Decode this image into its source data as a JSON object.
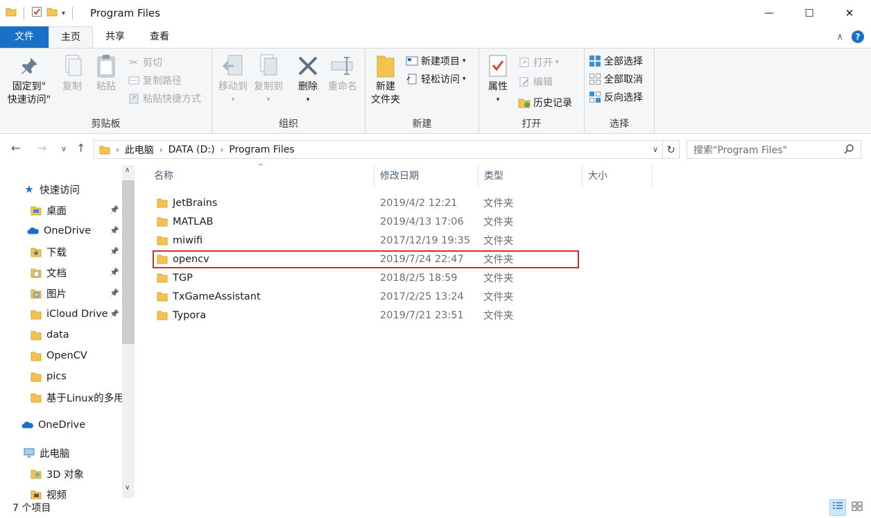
{
  "window": {
    "title": "Program Files",
    "min_glyph": "—",
    "max_glyph": "☐",
    "close_glyph": "✕"
  },
  "ribbon_tabs": [
    "文件",
    "主页",
    "共享",
    "查看"
  ],
  "ribbon": {
    "clipboard": {
      "label": "剪贴板",
      "pin_line1": "固定到\"",
      "pin_line2": "快速访问\"",
      "copy": "复制",
      "paste": "粘贴",
      "cut": "剪切",
      "copy_path": "复制路径",
      "paste_shortcut": "粘贴快捷方式"
    },
    "organize": {
      "label": "组织",
      "move_to": "移动到",
      "copy_to": "复制到",
      "delete": "删除",
      "rename": "重命名"
    },
    "new": {
      "label": "新建",
      "new_folder_line1": "新建",
      "new_folder_line2": "文件夹",
      "new_item": "新建项目",
      "easy_access": "轻松访问"
    },
    "open": {
      "label": "打开",
      "properties": "属性",
      "open": "打开",
      "edit": "编辑",
      "history": "历史记录"
    },
    "select": {
      "label": "选择",
      "select_all": "全部选择",
      "select_none": "全部取消",
      "invert": "反向选择"
    }
  },
  "address": {
    "crumbs": [
      "此电脑",
      "DATA (D:)",
      "Program Files"
    ],
    "search_placeholder": "搜索\"Program Files\""
  },
  "nav_pane": {
    "quick_access": "快速访问",
    "items": [
      {
        "label": "桌面",
        "pinned": true,
        "icon": "desktop-folder-icon"
      },
      {
        "label": "OneDrive",
        "pinned": true,
        "icon": "onedrive-cloud-icon"
      },
      {
        "label": "下载",
        "pinned": true,
        "icon": "downloads-folder-icon"
      },
      {
        "label": "文档",
        "pinned": true,
        "icon": "documents-folder-icon"
      },
      {
        "label": "图片",
        "pinned": true,
        "icon": "pictures-folder-icon"
      },
      {
        "label": "iCloud Drive",
        "pinned": true,
        "icon": "folder-icon"
      },
      {
        "label": "data",
        "pinned": false,
        "icon": "folder-icon"
      },
      {
        "label": "OpenCV",
        "pinned": false,
        "icon": "folder-icon"
      },
      {
        "label": "pics",
        "pinned": false,
        "icon": "folder-icon"
      },
      {
        "label": "基于Linux的多用",
        "pinned": false,
        "icon": "folder-icon"
      }
    ],
    "onedrive": "OneDrive",
    "this_pc": "此电脑",
    "objects_3d": "3D 对象",
    "videos": "视频"
  },
  "columns": [
    "名称",
    "修改日期",
    "类型",
    "大小"
  ],
  "files": [
    {
      "name": "JetBrains",
      "date": "2019/4/2 12:21",
      "type": "文件夹"
    },
    {
      "name": "MATLAB",
      "date": "2019/4/13 17:06",
      "type": "文件夹"
    },
    {
      "name": "miwifi",
      "date": "2017/12/19 19:35",
      "type": "文件夹"
    },
    {
      "name": "opencv",
      "date": "2019/7/24 22:47",
      "type": "文件夹"
    },
    {
      "name": "TGP",
      "date": "2018/2/5 18:59",
      "type": "文件夹"
    },
    {
      "name": "TxGameAssistant",
      "date": "2017/2/25 13:24",
      "type": "文件夹"
    },
    {
      "name": "Typora",
      "date": "2019/7/21 23:51",
      "type": "文件夹"
    }
  ],
  "status": {
    "count": "7 个项目"
  },
  "colors": {
    "accent": "#1a6fc7",
    "folder": "#f4c24f",
    "highlight_border": "#e0262b"
  }
}
